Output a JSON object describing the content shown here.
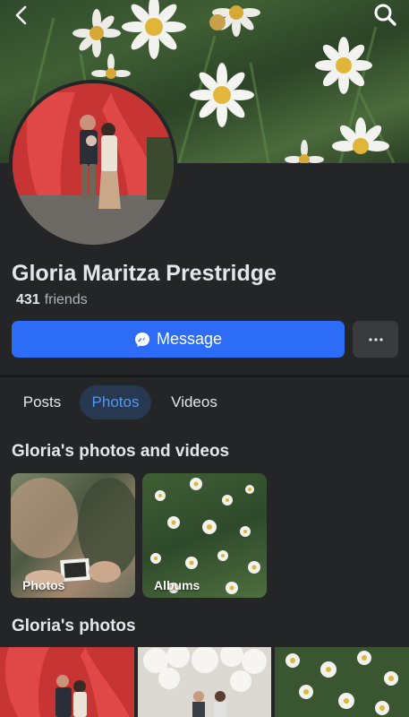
{
  "nav": {
    "back_icon": "chevron-left-icon",
    "search_icon": "search-icon"
  },
  "profile": {
    "name": "Gloria Maritza Prestridge",
    "friends_count": "431",
    "friends_label": "friends"
  },
  "actions": {
    "message_label": "Message",
    "more_label": "···"
  },
  "tabs": [
    {
      "label": "Posts",
      "active": false
    },
    {
      "label": "Photos",
      "active": true
    },
    {
      "label": "Videos",
      "active": false
    }
  ],
  "sections": {
    "photos_and_videos_title": "Gloria's photos and videos",
    "photos_title": "Gloria's photos"
  },
  "albums": [
    {
      "label": "Photos"
    },
    {
      "label": "Albums"
    }
  ],
  "colors": {
    "accent": "#2d6cf6",
    "active_tab_text": "#4e97ff",
    "background": "#242526"
  }
}
